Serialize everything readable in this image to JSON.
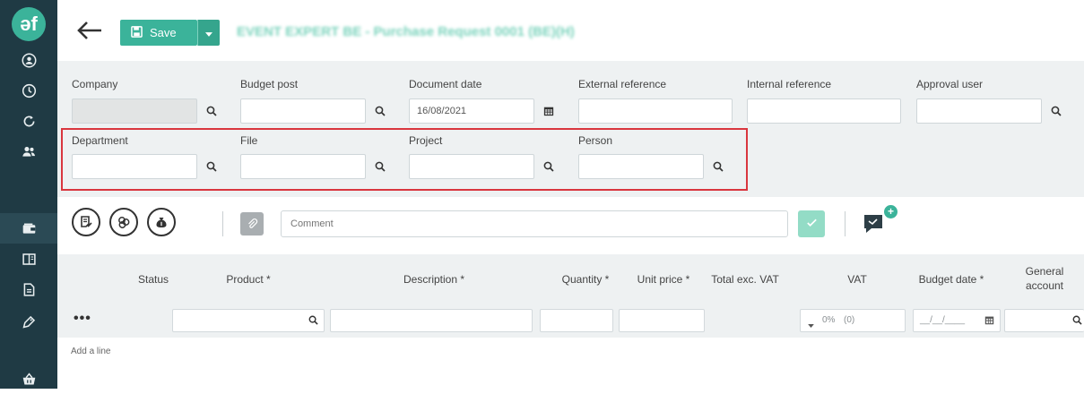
{
  "app": {
    "logo_text": "əf"
  },
  "sidebar": {
    "items": [
      {
        "icon": "user-circle-icon"
      },
      {
        "icon": "clock-icon"
      },
      {
        "icon": "refresh-icon"
      },
      {
        "icon": "users-icon"
      },
      {
        "icon": "wallet-icon"
      },
      {
        "icon": "book-icon"
      },
      {
        "icon": "document-icon"
      },
      {
        "icon": "tag-icon"
      },
      {
        "icon": "basket-icon"
      }
    ]
  },
  "header": {
    "save_label": "Save",
    "title": "EVENT EXPERT BE - Purchase Request 0001 (BE)(H)"
  },
  "form": {
    "row1": [
      {
        "label": "Company",
        "value": ""
      },
      {
        "label": "Budget post",
        "value": ""
      },
      {
        "label": "Document date",
        "value": "16/08/2021"
      },
      {
        "label": "External reference",
        "value": ""
      },
      {
        "label": "Internal reference",
        "value": ""
      },
      {
        "label": "Approval user",
        "value": ""
      }
    ],
    "row2": [
      {
        "label": "Department",
        "value": ""
      },
      {
        "label": "File",
        "value": ""
      },
      {
        "label": "Project",
        "value": ""
      },
      {
        "label": "Person",
        "value": ""
      }
    ]
  },
  "toolbar": {
    "comment_placeholder": "Comment",
    "badge_plus": "+"
  },
  "table": {
    "headers": {
      "status": "Status",
      "product": "Product *",
      "description": "Description *",
      "quantity": "Quantity *",
      "unit_price": "Unit price *",
      "total": "Total exc. VAT",
      "vat": "VAT",
      "budget_date": "Budget date *",
      "general_account_1": "General",
      "general_account_2": "account"
    },
    "row": {
      "menu": "•••",
      "vat_value": "0%",
      "vat_amount": "(0)",
      "budget_date_placeholder": "__/__/____"
    },
    "add_line": "Add a line"
  },
  "colors": {
    "sidebar": "#1f3a44",
    "accent": "#3bb39a",
    "highlight": "#d9363e",
    "panel": "#eef1f2"
  }
}
